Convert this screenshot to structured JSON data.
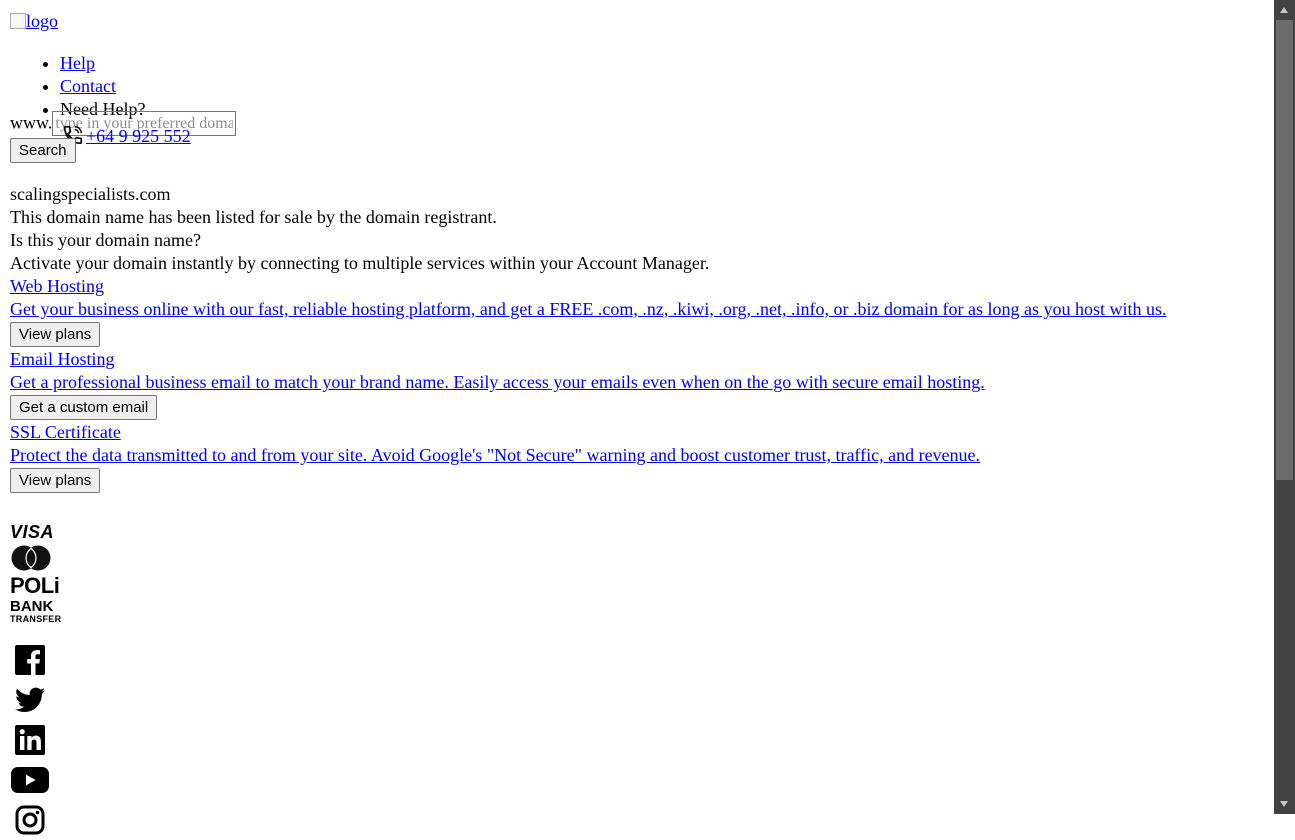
{
  "header": {
    "logo_alt": "logo",
    "nav": [
      {
        "label": "Help"
      },
      {
        "label": "Contact"
      },
      {
        "label": "Need Help?"
      }
    ],
    "phone": "+64 9 925 552"
  },
  "search": {
    "prefix": "www.",
    "placeholder": "type in your preferred domain",
    "button_label": "Search"
  },
  "domain": {
    "name": "scalingspecialists.com",
    "listed_text": "This domain name has been listed for sale by the domain registrant.",
    "question": "Is this your domain name?",
    "activate_text": "Activate your domain instantly by connecting to multiple services within your Account Manager."
  },
  "services": [
    {
      "title": "Web Hosting",
      "description": "Get your business online with our fast, reliable hosting platform, and get a FREE .com, .nz, .kiwi, .org, .net, .info, or .biz domain for as long as you host with us.",
      "button_label": "View plans"
    },
    {
      "title": "Email Hosting",
      "description": "Get a professional business email to match your brand name. Easily access your emails even when on the go with secure email hosting.",
      "button_label": "Get a custom email"
    },
    {
      "title": "SSL Certificate",
      "description": "Protect the data transmitted to and from your site. Avoid Google's \"Not Secure\" warning and boost customer trust, traffic, and revenue.",
      "button_label": "View plans"
    }
  ],
  "payments": {
    "visa": "VISA",
    "poli": "POLi",
    "bank_line1": "BANK",
    "bank_line2": "TRANSFER",
    "icons": [
      "visa-logo",
      "mastercard-logo",
      "poli-logo",
      "bank-transfer-logo"
    ]
  },
  "social": {
    "icons": [
      "facebook-icon",
      "twitter-icon",
      "linkedin-icon",
      "youtube-icon",
      "instagram-icon"
    ]
  },
  "colors": {
    "link": "#0000ee",
    "text": "#000000",
    "button_bg": "#efefef",
    "scroll_track": "#424242",
    "scroll_thumb": "#6b6b6b"
  }
}
